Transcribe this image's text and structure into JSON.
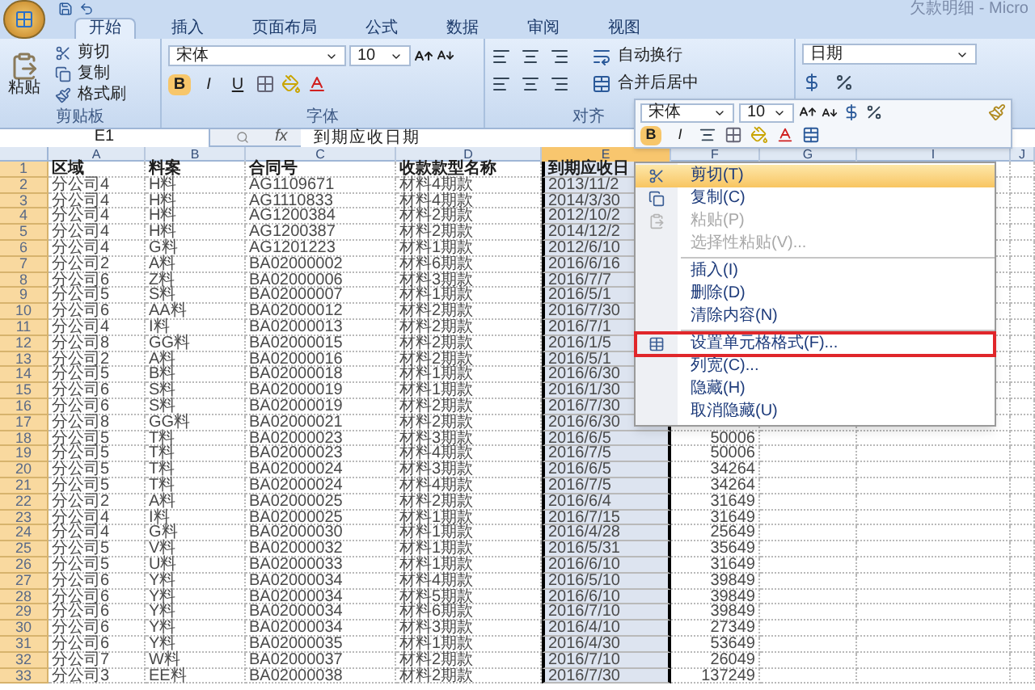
{
  "window": {
    "title": "欠款明细 - Micro"
  },
  "tabs": [
    {
      "label": "开始",
      "selected": true
    },
    {
      "label": "插入",
      "selected": false
    },
    {
      "label": "页面布局",
      "selected": false
    },
    {
      "label": "公式",
      "selected": false
    },
    {
      "label": "数据",
      "selected": false
    },
    {
      "label": "审阅",
      "selected": false
    },
    {
      "label": "视图",
      "selected": false
    }
  ],
  "ribbon": {
    "clipboard": {
      "paste": "粘贴",
      "items": [
        "剪切",
        "复制",
        "格式刷"
      ],
      "label": "剪贴板"
    },
    "font": {
      "name": "宋体",
      "size": "10",
      "bold": "B",
      "italic": "I",
      "underline": "U",
      "label": "字体"
    },
    "alignment": {
      "wrap": "自动换行",
      "merge": "合并后居中",
      "label": "对齐"
    },
    "number": {
      "format": "日期"
    }
  },
  "formula_bar": {
    "cell": "E1",
    "fx": "fx",
    "value": "到期应收日期"
  },
  "columns": [
    {
      "label": "A",
      "selected": false
    },
    {
      "label": "B",
      "selected": false
    },
    {
      "label": "C",
      "selected": false
    },
    {
      "label": "D",
      "selected": false
    },
    {
      "label": "E",
      "selected": true
    },
    {
      "label": "F",
      "selected": false
    },
    {
      "label": "G",
      "selected": false
    },
    {
      "label": "I",
      "selected": false
    },
    {
      "label": "J",
      "selected": false
    }
  ],
  "rows": [
    {
      "number": "1",
      "cells": [
        "区域",
        "料案",
        "合同号",
        "收款款型名称",
        "到期应收日"
      ]
    },
    {
      "number": "2",
      "cells": [
        "分公司4",
        "H料",
        "AG1109671",
        "材料4期款",
        "2013/11/2"
      ]
    },
    {
      "number": "3",
      "cells": [
        "分公司4",
        "H料",
        "AG1110833",
        "材料4期款",
        "2014/3/30"
      ]
    },
    {
      "number": "4",
      "cells": [
        "分公司4",
        "H料",
        "AG1200384",
        "材料2期款",
        "2012/10/2"
      ]
    },
    {
      "number": "5",
      "cells": [
        "分公司4",
        "H料",
        "AG1200387",
        "材料2期款",
        "2014/12/2"
      ]
    },
    {
      "number": "6",
      "cells": [
        "分公司4",
        "G料",
        "AG1201223",
        "材料1期款",
        "2012/6/10"
      ]
    },
    {
      "number": "7",
      "cells": [
        "分公司2",
        "A料",
        "BA02000002",
        "材料6期款",
        "2016/6/16"
      ]
    },
    {
      "number": "8",
      "cells": [
        "分公司6",
        "Z料",
        "BA02000006",
        "材料3期款",
        "2016/7/7"
      ]
    },
    {
      "number": "9",
      "cells": [
        "分公司5",
        "S料",
        "BA02000007",
        "材料1期款",
        "2016/5/1"
      ]
    },
    {
      "number": "10",
      "cells": [
        "分公司6",
        "AA料",
        "BA02000012",
        "材料2期款",
        "2016/7/30"
      ]
    },
    {
      "number": "11",
      "cells": [
        "分公司4",
        "I料",
        "BA02000013",
        "材料2期款",
        "2016/7/1"
      ]
    },
    {
      "number": "12",
      "cells": [
        "分公司8",
        "GG料",
        "BA02000015",
        "材料2期款",
        "2016/1/5"
      ]
    },
    {
      "number": "13",
      "cells": [
        "分公司2",
        "A料",
        "BA02000016",
        "材料2期款",
        "2016/5/1"
      ]
    },
    {
      "number": "14",
      "cells": [
        "分公司5",
        "B料",
        "BA02000018",
        "材料1期款",
        "2016/6/30"
      ]
    },
    {
      "number": "15",
      "cells": [
        "分公司6",
        "S料",
        "BA02000019",
        "材料1期款",
        "2016/1/30"
      ]
    },
    {
      "number": "16",
      "cells": [
        "分公司6",
        "S料",
        "BA02000019",
        "材料2期款",
        "2016/7/30"
      ]
    },
    {
      "number": "17",
      "cells": [
        "分公司8",
        "GG料",
        "BA02000021",
        "材料2期款",
        "2016/6/30"
      ]
    },
    {
      "number": "18",
      "cells": [
        "分公司5",
        "T料",
        "BA02000023",
        "材料3期款",
        "2016/6/5",
        "50006"
      ]
    },
    {
      "number": "19",
      "cells": [
        "分公司5",
        "T料",
        "BA02000023",
        "材料4期款",
        "2016/7/5",
        "50006"
      ]
    },
    {
      "number": "20",
      "cells": [
        "分公司5",
        "T料",
        "BA02000024",
        "材料3期款",
        "2016/6/5",
        "34264"
      ]
    },
    {
      "number": "21",
      "cells": [
        "分公司5",
        "T料",
        "BA02000024",
        "材料4期款",
        "2016/7/5",
        "34264"
      ]
    },
    {
      "number": "22",
      "cells": [
        "分公司2",
        "A料",
        "BA02000025",
        "材料2期款",
        "2016/6/4",
        "31649"
      ]
    },
    {
      "number": "23",
      "cells": [
        "分公司4",
        "I料",
        "BA02000025",
        "材料1期款",
        "2016/7/15",
        "31649"
      ]
    },
    {
      "number": "24",
      "cells": [
        "分公司4",
        "G料",
        "BA02000030",
        "材料1期款",
        "2016/4/28",
        "25649"
      ]
    },
    {
      "number": "25",
      "cells": [
        "分公司5",
        "V料",
        "BA02000032",
        "材料1期款",
        "2016/5/31",
        "35649"
      ]
    },
    {
      "number": "26",
      "cells": [
        "分公司5",
        "U料",
        "BA02000033",
        "材料1期款",
        "2016/6/10",
        "31649"
      ]
    },
    {
      "number": "27",
      "cells": [
        "分公司6",
        "Y料",
        "BA02000034",
        "材料4期款",
        "2016/5/10",
        "39849"
      ]
    },
    {
      "number": "28",
      "cells": [
        "分公司6",
        "Y料",
        "BA02000034",
        "材料5期款",
        "2016/6/10",
        "39849"
      ]
    },
    {
      "number": "29",
      "cells": [
        "分公司6",
        "Y料",
        "BA02000034",
        "材料6期款",
        "2016/7/10",
        "39849"
      ]
    },
    {
      "number": "30",
      "cells": [
        "分公司6",
        "Y料",
        "BA02000034",
        "材料3期款",
        "2016/4/10",
        "27349"
      ]
    },
    {
      "number": "31",
      "cells": [
        "分公司6",
        "Y料",
        "BA02000035",
        "材料1期款",
        "2016/4/30",
        "53649"
      ]
    },
    {
      "number": "32",
      "cells": [
        "分公司7",
        "W料",
        "BA02000037",
        "材料2期款",
        "2016/7/10",
        "26049"
      ]
    },
    {
      "number": "33",
      "cells": [
        "分公司3",
        "EE料",
        "BA02000038",
        "材料2期款",
        "2016/7/30",
        "137249"
      ]
    }
  ],
  "mini_toolbar": {
    "font": "宋体",
    "size": "10",
    "bold": "B",
    "italic": "I"
  },
  "context_menu": [
    {
      "kind": "cut",
      "label": "剪切(T)",
      "highlighted": true,
      "disabled": false,
      "annotated": false
    },
    {
      "kind": "copy",
      "label": "复制(C)",
      "highlighted": false,
      "disabled": false,
      "annotated": false
    },
    {
      "kind": "paste",
      "label": "粘贴(P)",
      "highlighted": false,
      "disabled": true,
      "annotated": false
    },
    {
      "kind": "item",
      "label": "选择性粘贴(V)...",
      "highlighted": false,
      "disabled": true,
      "annotated": false
    },
    {
      "kind": "separator"
    },
    {
      "kind": "item",
      "label": "插入(I)",
      "highlighted": false,
      "disabled": false,
      "annotated": false
    },
    {
      "kind": "item",
      "label": "删除(D)",
      "highlighted": false,
      "disabled": false,
      "annotated": false
    },
    {
      "kind": "item",
      "label": "清除内容(N)",
      "highlighted": false,
      "disabled": false,
      "annotated": false
    },
    {
      "kind": "separator"
    },
    {
      "kind": "format",
      "label": "设置单元格格式(F)...",
      "highlighted": false,
      "disabled": false,
      "annotated": true
    },
    {
      "kind": "item",
      "label": "列宽(C)...",
      "highlighted": false,
      "disabled": false,
      "annotated": false
    },
    {
      "kind": "item",
      "label": "隐藏(H)",
      "highlighted": false,
      "disabled": false,
      "annotated": false
    },
    {
      "kind": "item",
      "label": "取消隐藏(U)",
      "highlighted": false,
      "disabled": false,
      "annotated": false
    }
  ]
}
